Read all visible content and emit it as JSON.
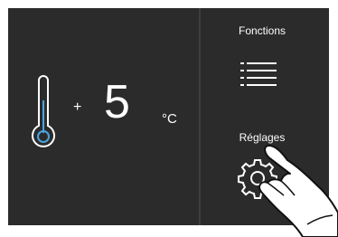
{
  "display": {
    "temperature_sign": "+",
    "temperature_value": "5",
    "temperature_unit": "°C"
  },
  "menu": {
    "functions_label": "Fonctions",
    "settings_label": "Réglages"
  },
  "icons": {
    "thermometer": "thermometer-icon",
    "functions": "list-menu-icon",
    "settings": "gear-icon"
  },
  "colors": {
    "panel_background": "#2b2b2b",
    "foreground": "#ffffff"
  }
}
